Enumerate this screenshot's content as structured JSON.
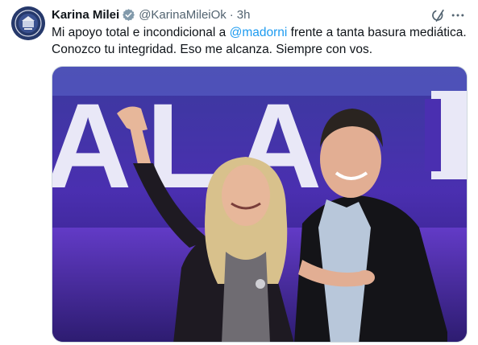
{
  "author": {
    "name": "Karina Milei",
    "handle": "@KarinaMileiOk",
    "separator": "·",
    "time": "3h"
  },
  "icons": {
    "avatar": "seal-avatar",
    "verified": "verified-badge-icon",
    "grok": "grok-icon",
    "more": "more-icon"
  },
  "colors": {
    "accent": "#1d9bf0",
    "verified": "#829aab",
    "text": "#0f1419",
    "muted": "#536471"
  },
  "tweet": {
    "text_before": "Mi apoyo total e incondicional a ",
    "mention": "@madorni",
    "text_after": " frente a tanta basura mediática. Conozco tu integridad. Eso me alcanza. Siempre con vos."
  },
  "media": {
    "backdrop_letters": "ALA"
  }
}
